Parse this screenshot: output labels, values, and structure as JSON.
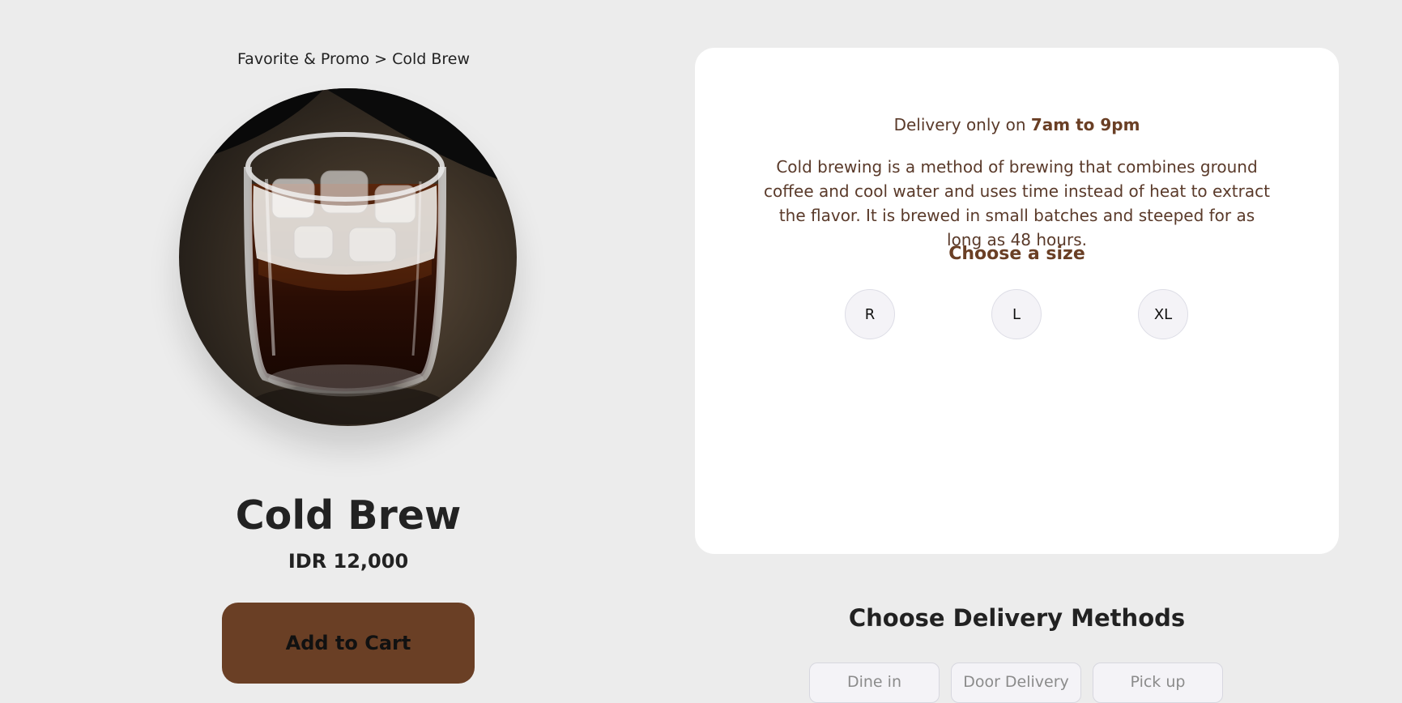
{
  "breadcrumb": "Favorite & Promo > Cold Brew",
  "product": {
    "name": "Cold Brew",
    "price": "IDR 12,000",
    "add_to_cart_label": "Add to Cart",
    "image_icon": "cold-brew-photo"
  },
  "info": {
    "delivery_prefix": "Delivery only on ",
    "delivery_hours": "7am to 9pm",
    "description": "Cold brewing is a method of brewing that combines ground coffee and cool water and uses time instead of heat to extract the flavor. It is brewed in small batches and steeped for as long as 48 hours.",
    "size_title": "Choose a size",
    "sizes": [
      "R",
      "L",
      "XL"
    ]
  },
  "delivery": {
    "title": "Choose Delivery Methods",
    "methods": [
      "Dine in",
      "Door Delivery",
      "Pick up"
    ]
  },
  "colors": {
    "background": "#ececec",
    "card": "#ffffff",
    "accent_brown": "#6a3f25",
    "text_brown": "#5a3a2a"
  }
}
